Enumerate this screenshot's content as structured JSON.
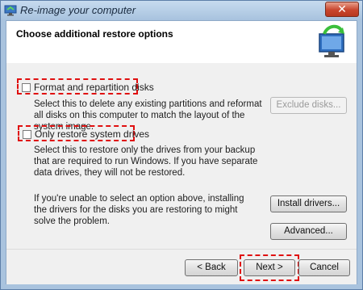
{
  "window": {
    "title": "Re-image your computer",
    "close_glyph": "✕"
  },
  "header": {
    "title": "Choose additional restore options"
  },
  "options": {
    "format": {
      "label": "Format and repartition disks",
      "description": "Select this to delete any existing partitions and reformat all disks on this computer to match the layout of the system image.",
      "button": "Exclude disks...",
      "checked": false
    },
    "system_drives": {
      "label": "Only restore system drives",
      "description": "Select this to restore only the drives from your backup that are required to run Windows. If you have separate data drives, they will not be restored.",
      "checked": false
    }
  },
  "drivers": {
    "text": "If you're unable to select an option above, installing the drivers for the disks you are restoring to might solve the problem.",
    "install_button": "Install drivers...",
    "advanced_button": "Advanced..."
  },
  "footer": {
    "back": "< Back",
    "next": "Next >",
    "cancel": "Cancel"
  },
  "colors": {
    "highlight": "#e01010",
    "title_bar": "#a9c3de"
  }
}
